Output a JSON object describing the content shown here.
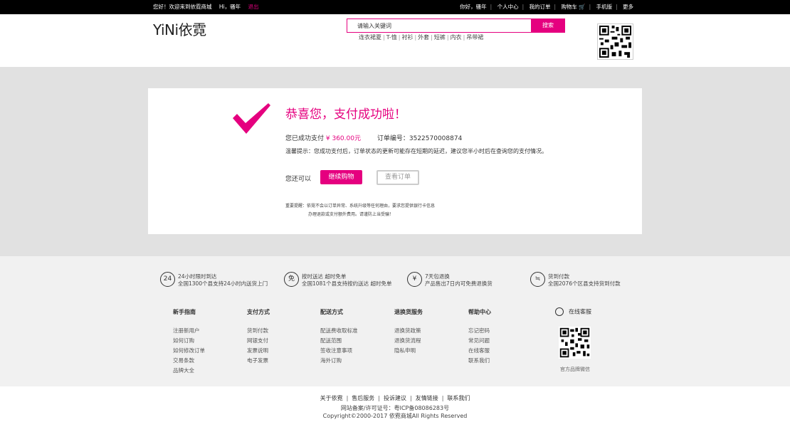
{
  "topbar": {
    "welcome": "您好！欢迎来到依霓商城",
    "greeting": "Hi，骚年",
    "logout": "退出",
    "links": [
      "你好，骚年",
      "个人中心",
      "我的订单",
      "购物车",
      "手机版",
      "更多"
    ]
  },
  "header": {
    "logo": "YiNi依霓",
    "search_placeholder": "请输入关键词",
    "search_button": "搜索",
    "hotwords": [
      "连衣裙夏",
      "T-恤",
      "衬衫",
      "外套",
      "短裤",
      "内衣",
      "吊带裙"
    ]
  },
  "result": {
    "title": "恭喜您，支付成功啦！",
    "paid_prefix": "您已成功支付",
    "amount": "¥ 360.00元",
    "order_label": "订单编号：",
    "order_no": "3522570008874",
    "tip": "温馨提示：您成功支付后，订单状态的更新可能存在短期的延迟，建议您半小时后在查询您的支付情况。",
    "also_label": "您还可以",
    "continue_button": "继续购物",
    "view_order_button": "查看订单",
    "notice_line1": "重要提醒：依霓不会以订单异常、系统升级等任何理由，要求您提供银行卡信息",
    "notice_line2": "办理退款或支付额外费用。请谨防上当受骗！"
  },
  "services": [
    {
      "icon": "24hr-icon",
      "glyph": "24",
      "line1": "24小时限时到达",
      "line2": "全国1300个县支持24小时内送货上门"
    },
    {
      "icon": "free-icon",
      "glyph": "免",
      "line1": "按时送达 超时免单",
      "line2": "全国1081个县支持按约送达 超时免单"
    },
    {
      "icon": "yen-icon",
      "glyph": "¥",
      "line1": "7天包退换",
      "line2": "产品售出7日内可免费退换货"
    },
    {
      "icon": "cod-icon",
      "glyph": "≒",
      "line1": "货到付款",
      "line2": "全国2076个区县支持货到付款"
    }
  ],
  "footer_columns": [
    {
      "heading": "新手指南",
      "items": [
        "注册新用户",
        "如何订购",
        "如何修改订单",
        "交易条款",
        "品牌大全"
      ]
    },
    {
      "heading": "支付方式",
      "items": [
        "货到付款",
        "网银支付",
        "发票说明",
        "电子发票"
      ]
    },
    {
      "heading": "配送方式",
      "items": [
        "配送费收取标准",
        "配送范围",
        "签收注意事项",
        "海外订购"
      ]
    },
    {
      "heading": "退换货服务",
      "items": [
        "退换货政策",
        "退换货流程",
        "隐私申明"
      ]
    },
    {
      "heading": "帮助中心",
      "items": [
        "忘记密码",
        "常见问题",
        "在线客服",
        "联系我们"
      ]
    }
  ],
  "customer_service": {
    "label": "在线客服",
    "qr_caption": "官方品牌微信"
  },
  "bottom": {
    "links": [
      "关于依霓",
      "售后服务",
      "投诉建议",
      "友情链接",
      "联系我们"
    ],
    "icp": "网站备案/许可证号：粤ICP备08086283号",
    "copyright": "Copyright©2000-2017 依霓商城All Rights Reserved"
  },
  "colors": {
    "accent": "#e5007f",
    "topbar_bg": "#000000",
    "content_bg": "#e1e1e1",
    "footer_bg": "#f1f1f1"
  }
}
